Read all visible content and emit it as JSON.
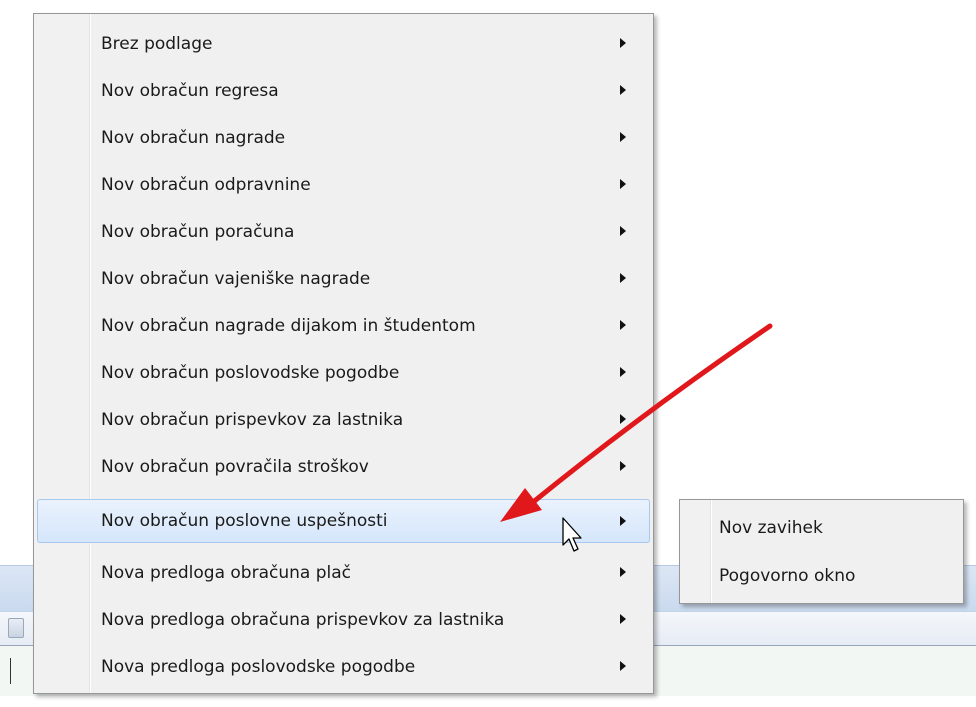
{
  "context_menu": {
    "items": [
      {
        "label": "Brez podlage",
        "has_submenu": true
      },
      {
        "label": "Nov obračun regresa",
        "has_submenu": true
      },
      {
        "label": "Nov obračun nagrade",
        "has_submenu": true
      },
      {
        "label": "Nov obračun odpravnine",
        "has_submenu": true
      },
      {
        "label": "Nov obračun poračuna",
        "has_submenu": true
      },
      {
        "label": "Nov obračun vajeniške nagrade",
        "has_submenu": true
      },
      {
        "label": "Nov obračun nagrade dijakom in študentom",
        "has_submenu": true
      },
      {
        "label": "Nov obračun poslovodske pogodbe",
        "has_submenu": true
      },
      {
        "label": "Nov obračun prispevkov za lastnika",
        "has_submenu": true
      },
      {
        "label": "Nov obračun povračila stroškov",
        "has_submenu": true
      },
      {
        "label": "Nov obračun poslovne uspešnosti",
        "has_submenu": true,
        "highlighted": true
      },
      {
        "label": "Nova predloga obračuna plač",
        "has_submenu": true
      },
      {
        "label": "Nova predloga obračuna prispevkov za lastnika",
        "has_submenu": true
      },
      {
        "label": "Nova predloga poslovodske pogodbe",
        "has_submenu": true
      }
    ]
  },
  "submenu": {
    "items": [
      {
        "label": "Nov zavihek"
      },
      {
        "label": "Pogovorno okno"
      }
    ]
  },
  "annotation": {
    "type": "red-arrow",
    "color": "#e0181b"
  },
  "colors": {
    "highlight": "#d5e6fb",
    "menu_bg": "#f0f0f0",
    "arrow": "#e0181b"
  }
}
